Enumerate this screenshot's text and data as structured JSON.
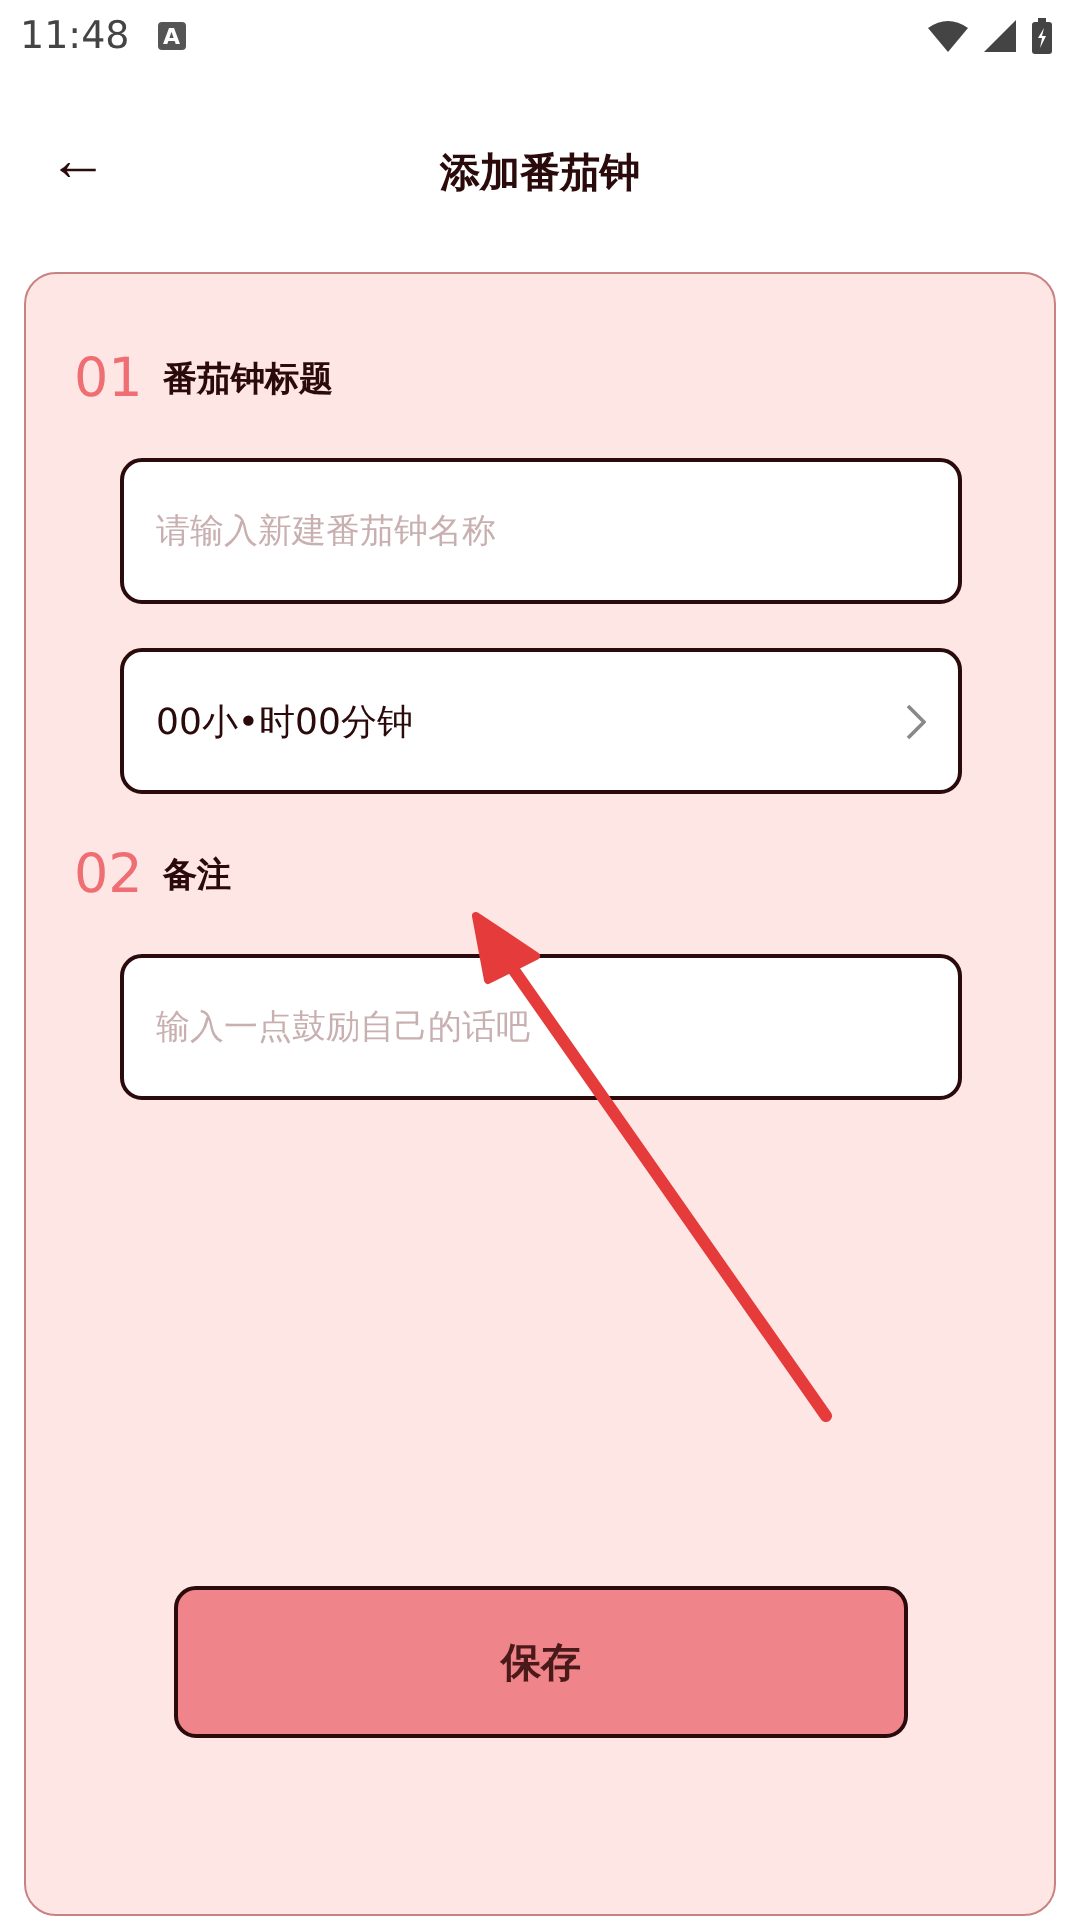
{
  "status_bar": {
    "time": "11:48",
    "notification_icon": "A"
  },
  "header": {
    "back": "←",
    "title": "添加番茄钟"
  },
  "sections": [
    {
      "number": "01",
      "label": "番茄钟标题",
      "fields": [
        {
          "kind": "input",
          "placeholder": "请输入新建番茄钟名称"
        },
        {
          "kind": "picker",
          "value": "00小•时00分钟"
        }
      ]
    },
    {
      "number": "02",
      "label": "备注",
      "fields": [
        {
          "kind": "input",
          "placeholder": "输入一点鼓励自己的话吧"
        }
      ]
    }
  ],
  "save_button": "保存",
  "annotation": {
    "kind": "arrow"
  }
}
